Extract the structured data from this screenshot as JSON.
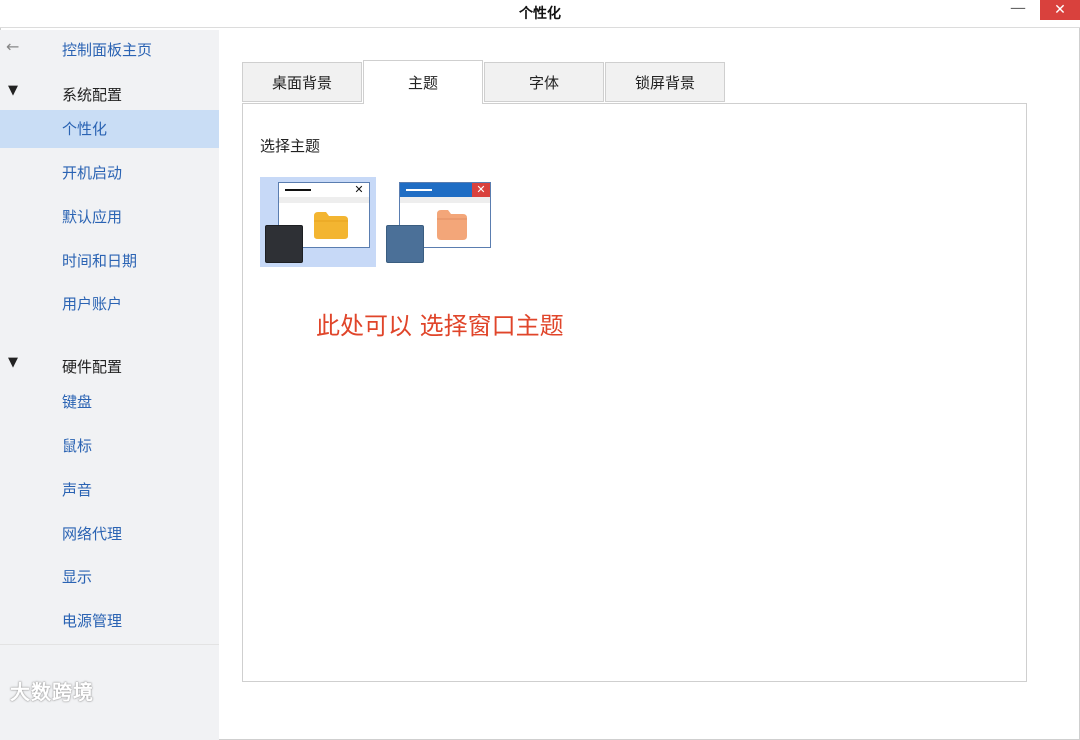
{
  "window": {
    "title": "个性化",
    "minimize_glyph": "—",
    "close_glyph": "✕"
  },
  "sidebar": {
    "back_icon": "←",
    "home_link": "控制面板主页",
    "system_section": {
      "triangle": "▼",
      "label": "系统配置"
    },
    "system_items": [
      {
        "label": "个性化",
        "selected": true
      },
      {
        "label": "开机启动"
      },
      {
        "label": "默认应用"
      },
      {
        "label": "时间和日期"
      },
      {
        "label": "用户账户"
      }
    ],
    "hardware_section": {
      "triangle": "▼",
      "label": "硬件配置"
    },
    "hardware_items": [
      {
        "label": "键盘"
      },
      {
        "label": "鼠标"
      },
      {
        "label": "声音"
      },
      {
        "label": "网络代理"
      },
      {
        "label": "显示"
      },
      {
        "label": "电源管理"
      }
    ],
    "watermark": "大数跨境"
  },
  "tabs": [
    {
      "label": "桌面背景"
    },
    {
      "label": "主题",
      "active": true
    },
    {
      "label": "字体"
    },
    {
      "label": "锁屏背景"
    }
  ],
  "main": {
    "section_title": "选择主题",
    "themes": [
      {
        "name": "dark",
        "selected": true,
        "titlebar": "#ffffff",
        "line": "#111111",
        "close_glyph": "✕",
        "close_bg": "#ffffff",
        "close_color": "#111111",
        "folder_color": "#f3b531",
        "square_color": "#2e3035"
      },
      {
        "name": "blue",
        "selected": false,
        "titlebar": "#1f6dc4",
        "line": "#ffffff",
        "close_glyph": "✕",
        "close_bg": "#d9413d",
        "close_color": "#ffffff",
        "folder_color": "#f3a679",
        "square_color": "#4b7098"
      }
    ],
    "annotation": "此处可以 选择窗口主题"
  },
  "colors": {
    "accent_link": "#2a63b3",
    "selected_bg": "#c9ddf5",
    "annotation": "#e0452a",
    "close_button": "#d9413d"
  }
}
